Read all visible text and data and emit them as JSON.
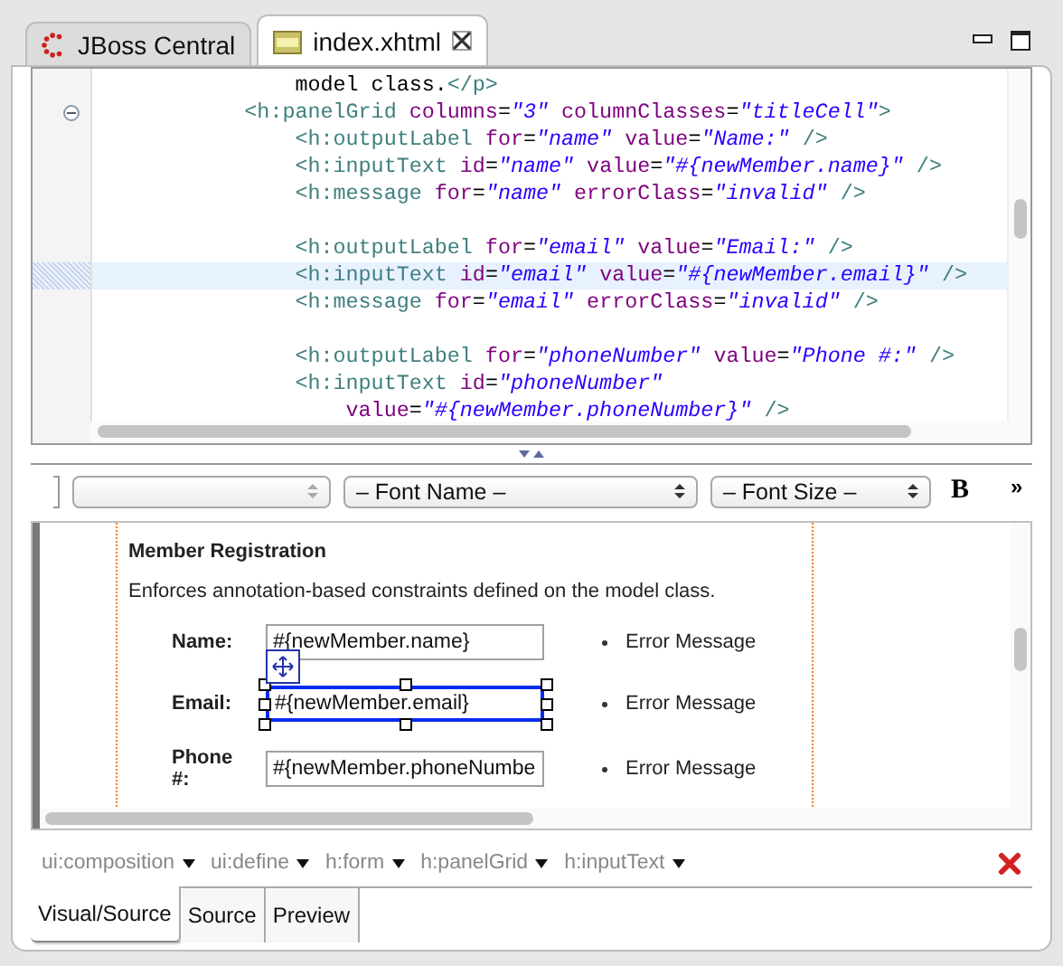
{
  "tabs": [
    {
      "label": "JBoss Central",
      "kind": "jboss",
      "selected": false,
      "closable": false
    },
    {
      "label": "index.xhtml",
      "kind": "html",
      "selected": true,
      "closable": true
    }
  ],
  "source": {
    "lines": [
      {
        "current": false,
        "segments": [
          {
            "kind": "text",
            "text": "                model class."
          },
          {
            "kind": "tag",
            "text": "</p>"
          }
        ]
      },
      {
        "current": false,
        "expanded": true,
        "segments": [
          {
            "kind": "tag",
            "text": "            <h:panelGrid"
          },
          {
            "kind": "attr",
            "text": " columns"
          },
          {
            "kind": "text",
            "text": "="
          },
          {
            "kind": "value",
            "text": "\"3\""
          },
          {
            "kind": "attr",
            "text": " columnClasses"
          },
          {
            "kind": "text",
            "text": "="
          },
          {
            "kind": "value",
            "text": "\"titleCell\""
          },
          {
            "kind": "tag",
            "text": ">"
          }
        ]
      },
      {
        "current": false,
        "segments": [
          {
            "kind": "tag",
            "text": "                <h:outputLabel"
          },
          {
            "kind": "attr",
            "text": " for"
          },
          {
            "kind": "text",
            "text": "="
          },
          {
            "kind": "value",
            "text": "\"name\""
          },
          {
            "kind": "attr",
            "text": " value"
          },
          {
            "kind": "text",
            "text": "="
          },
          {
            "kind": "value",
            "text": "\"Name:\""
          },
          {
            "kind": "tag",
            "text": " />"
          }
        ]
      },
      {
        "current": false,
        "segments": [
          {
            "kind": "tag",
            "text": "                <h:inputText"
          },
          {
            "kind": "attr",
            "text": " id"
          },
          {
            "kind": "text",
            "text": "="
          },
          {
            "kind": "value",
            "text": "\"name\""
          },
          {
            "kind": "attr",
            "text": " value"
          },
          {
            "kind": "text",
            "text": "="
          },
          {
            "kind": "value",
            "text": "\"#{newMember.name}\""
          },
          {
            "kind": "tag",
            "text": " />"
          }
        ]
      },
      {
        "current": false,
        "segments": [
          {
            "kind": "tag",
            "text": "                <h:message"
          },
          {
            "kind": "attr",
            "text": " for"
          },
          {
            "kind": "text",
            "text": "="
          },
          {
            "kind": "value",
            "text": "\"name\""
          },
          {
            "kind": "attr",
            "text": " errorClass"
          },
          {
            "kind": "text",
            "text": "="
          },
          {
            "kind": "value",
            "text": "\"invalid\""
          },
          {
            "kind": "tag",
            "text": " />"
          }
        ]
      },
      {
        "current": false
      },
      {
        "current": false,
        "segments": [
          {
            "kind": "tag",
            "text": "                <h:outputLabel"
          },
          {
            "kind": "attr",
            "text": " for"
          },
          {
            "kind": "text",
            "text": "="
          },
          {
            "kind": "value",
            "text": "\"email\""
          },
          {
            "kind": "attr",
            "text": " value"
          },
          {
            "kind": "text",
            "text": "="
          },
          {
            "kind": "value",
            "text": "\"Email:\""
          },
          {
            "kind": "tag",
            "text": " />"
          }
        ]
      },
      {
        "current": true,
        "segments": [
          {
            "kind": "tag",
            "text": "                <h:inputText"
          },
          {
            "kind": "attr",
            "text": " id"
          },
          {
            "kind": "text",
            "text": "="
          },
          {
            "kind": "value",
            "text": "\"email\""
          },
          {
            "kind": "attr",
            "text": " value"
          },
          {
            "kind": "text",
            "text": "="
          },
          {
            "kind": "value",
            "text": "\"#{newMember.email}\""
          },
          {
            "kind": "tag",
            "text": " />"
          }
        ]
      },
      {
        "current": false,
        "segments": [
          {
            "kind": "tag",
            "text": "                <h:message"
          },
          {
            "kind": "attr",
            "text": " for"
          },
          {
            "kind": "text",
            "text": "="
          },
          {
            "kind": "value",
            "text": "\"email\""
          },
          {
            "kind": "attr",
            "text": " errorClass"
          },
          {
            "kind": "text",
            "text": "="
          },
          {
            "kind": "value",
            "text": "\"invalid\""
          },
          {
            "kind": "tag",
            "text": " />"
          }
        ]
      },
      {
        "current": false
      },
      {
        "current": false,
        "segments": [
          {
            "kind": "tag",
            "text": "                <h:outputLabel"
          },
          {
            "kind": "attr",
            "text": " for"
          },
          {
            "kind": "text",
            "text": "="
          },
          {
            "kind": "value",
            "text": "\"phoneNumber\""
          },
          {
            "kind": "attr",
            "text": " value"
          },
          {
            "kind": "text",
            "text": "="
          },
          {
            "kind": "value",
            "text": "\"Phone #:\""
          },
          {
            "kind": "tag",
            "text": " />"
          }
        ]
      },
      {
        "current": false,
        "segments": [
          {
            "kind": "tag",
            "text": "                <h:inputText"
          },
          {
            "kind": "attr",
            "text": " id"
          },
          {
            "kind": "text",
            "text": "="
          },
          {
            "kind": "value",
            "text": "\"phoneNumber\""
          }
        ]
      },
      {
        "current": false,
        "segments": [
          {
            "kind": "attr",
            "text": "                    value"
          },
          {
            "kind": "text",
            "text": "="
          },
          {
            "kind": "value",
            "text": "\"#{newMember.phoneNumber}\""
          },
          {
            "kind": "tag",
            "text": " />"
          }
        ]
      }
    ]
  },
  "toolbar": {
    "font_name": "– Font Name –",
    "font_size": "– Font Size –",
    "bold": "B",
    "more": "»"
  },
  "visual": {
    "title": "Member Registration",
    "intro": "Enforces annotation-based constraints defined on the model class.",
    "rows": [
      {
        "label": "Name:",
        "value": "#{newMember.name}",
        "message": "Error Message",
        "selected": false
      },
      {
        "label": "Email:",
        "value": "#{newMember.email}",
        "message": "Error Message",
        "selected": true
      },
      {
        "label": "Phone #:",
        "value": "#{newMember.phoneNumbe",
        "message": "Error Message",
        "selected": false
      }
    ]
  },
  "breadcrumb": [
    "ui:composition",
    "ui:define",
    "h:form",
    "h:panelGrid",
    "h:inputText"
  ],
  "bottom_tabs": [
    {
      "label": "Visual/Source",
      "selected": true
    },
    {
      "label": "Source",
      "selected": false
    },
    {
      "label": "Preview",
      "selected": false
    }
  ]
}
